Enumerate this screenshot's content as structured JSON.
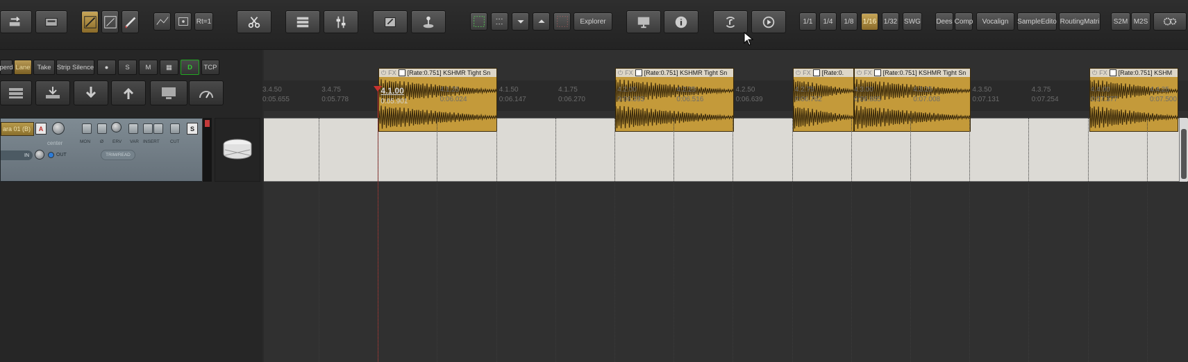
{
  "toolbar": {
    "groups": [
      {
        "items": [
          "undo-arrow-icon",
          "disk-icon"
        ]
      },
      {
        "items": [
          "grid-icon-1",
          "grid-icon-2",
          "pencil-icon"
        ]
      },
      {
        "items": [
          "envelope-icon",
          "ripple-icon"
        ],
        "label": "Rt=1"
      },
      {
        "items": [
          "scissors-icon"
        ]
      },
      {
        "items": [
          "mixer-icon",
          "fader-icon"
        ]
      },
      {
        "items": [
          "notepad-icon",
          "joystick-icon"
        ]
      }
    ],
    "explorer_label": "Explorer",
    "grid_labels": [
      "1/1",
      "1/4",
      "1/8",
      "1/16",
      "1/32",
      "SWG"
    ],
    "grid_active": "1/16",
    "app_labels": [
      "Dees",
      "Comp",
      "Vocalign",
      "SampleEdito",
      "RoutingMatri"
    ],
    "mode_labels": [
      "S2M",
      "M2S"
    ]
  },
  "left_buttons": {
    "row1": [
      "perd",
      "Lane",
      "Take",
      "Strip Silence",
      "●",
      "S",
      "M",
      "▦",
      "D",
      "TCP"
    ],
    "lane_active": "Lane"
  },
  "track": {
    "name": "ara 01 (B)",
    "arm_label": "A",
    "solo_label": "S",
    "pan_label": "center",
    "mini_labels": [
      "MON",
      "Ø",
      "ERV",
      "VAR",
      "INSERT",
      "CUT"
    ],
    "in_label": "IN",
    "out_label": "OUT",
    "trim_label": "TRIM/READ"
  },
  "ruler": {
    "ticks": [
      {
        "beat": "3.4.50",
        "time": "0:05.655"
      },
      {
        "beat": "3.4.75",
        "time": "0:05.778"
      },
      {
        "beat": "4.1.00",
        "time": "0:05.901",
        "highlight": true
      },
      {
        "beat": "4.1.25",
        "time": "0:06.024"
      },
      {
        "beat": "4.1.50",
        "time": "0:06.147"
      },
      {
        "beat": "4.1.75",
        "time": "0:06.270"
      },
      {
        "beat": "4.2.00",
        "time": "0:06.393"
      },
      {
        "beat": "4.2.25",
        "time": "0:06.516"
      },
      {
        "beat": "4.2.50",
        "time": "0:06.639"
      },
      {
        "beat": "4.2.75",
        "time": "0:06.762"
      },
      {
        "beat": "4.3.00",
        "time": "0:06.885"
      },
      {
        "beat": "4.3.25",
        "time": "0:07.008"
      },
      {
        "beat": "4.3.50",
        "time": "0:07.131"
      },
      {
        "beat": "4.3.75",
        "time": "0:07.254"
      },
      {
        "beat": "4.4.00",
        "time": "0:07.377"
      },
      {
        "beat": "4.4.25",
        "time": "0:07.500"
      }
    ]
  },
  "items": [
    {
      "label": "[Rate:0.751] KSHMR Tight Sn"
    },
    {
      "label": "[Rate:0.751] KSHMR Tight Sn"
    },
    {
      "label": "[Rate:0."
    },
    {
      "label": "[Rate:0.751] KSHMR Tight Sn"
    },
    {
      "label": "[Rate:0.751] KSHM"
    }
  ],
  "fx_label": "FX",
  "colors": {
    "item_fill": "#c49a3a",
    "playhead": "#c8322e",
    "track_header": "#7f8b93"
  }
}
